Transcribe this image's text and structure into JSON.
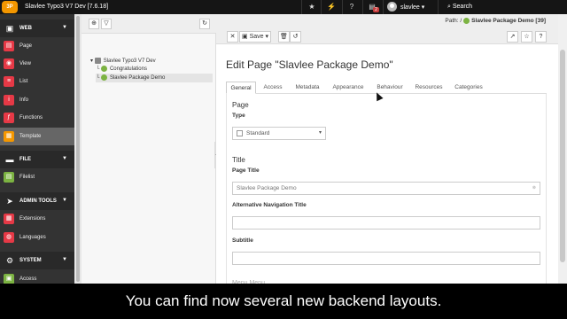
{
  "topbar": {
    "logo": "3P",
    "app_title": "Slavlee Typo3 V7 Dev [7.6.18]",
    "notification_count": "2",
    "username": "slavlee",
    "search_label": "Search",
    "icons": [
      "bookmark-star-icon",
      "flash-icon",
      "help-icon",
      "system-info-icon",
      "user-icon"
    ]
  },
  "modules": {
    "web": {
      "label": "WEB",
      "items": [
        {
          "label": "Page",
          "icon": "page-icon",
          "color": "#e63946"
        },
        {
          "label": "View",
          "icon": "view-icon",
          "color": "#e63946"
        },
        {
          "label": "List",
          "icon": "list-icon",
          "color": "#e63946"
        },
        {
          "label": "Info",
          "icon": "info-icon",
          "color": "#e63946"
        },
        {
          "label": "Functions",
          "icon": "functions-icon",
          "color": "#e63946"
        },
        {
          "label": "Template",
          "icon": "template-icon",
          "color": "#f49700"
        }
      ]
    },
    "file": {
      "label": "FILE",
      "items": [
        {
          "label": "Filelist",
          "icon": "filelist-icon",
          "color": "#7cb342"
        }
      ]
    },
    "admin": {
      "label": "ADMIN TOOLS",
      "items": [
        {
          "label": "Extensions",
          "icon": "extensions-icon",
          "color": "#e63946"
        },
        {
          "label": "Languages",
          "icon": "languages-icon",
          "color": "#e63946"
        }
      ]
    },
    "system": {
      "label": "SYSTEM",
      "items": [
        {
          "label": "Access",
          "icon": "access-icon",
          "color": "#7cb342"
        }
      ]
    }
  },
  "tree": {
    "root": "Slavlee Typo3 V7 Dev",
    "children": [
      "Congratulations",
      "Slavlee Package Demo"
    ]
  },
  "docheader": {
    "save_label": "Save",
    "path_prefix": "Path: /",
    "path_page": "Slavlee Package Demo [39]"
  },
  "main": {
    "heading": "Edit Page \"Slavlee Package Demo\"",
    "tabs": [
      "General",
      "Access",
      "Metadata",
      "Appearance",
      "Behaviour",
      "Resources",
      "Categories"
    ],
    "sections": {
      "page_title": "Page",
      "type_label": "Type",
      "type_value": "Standard",
      "title_section": "Title",
      "page_title_label": "Page Title",
      "page_title_value": "Slavlee Package Demo",
      "nav_title_label": "Alternative Navigation Title",
      "nav_title_value": "",
      "subtitle_label": "Subtitle",
      "subtitle_value": "",
      "more_label": "Menu Menu"
    }
  },
  "caption": "You can find now several new backend layouts."
}
